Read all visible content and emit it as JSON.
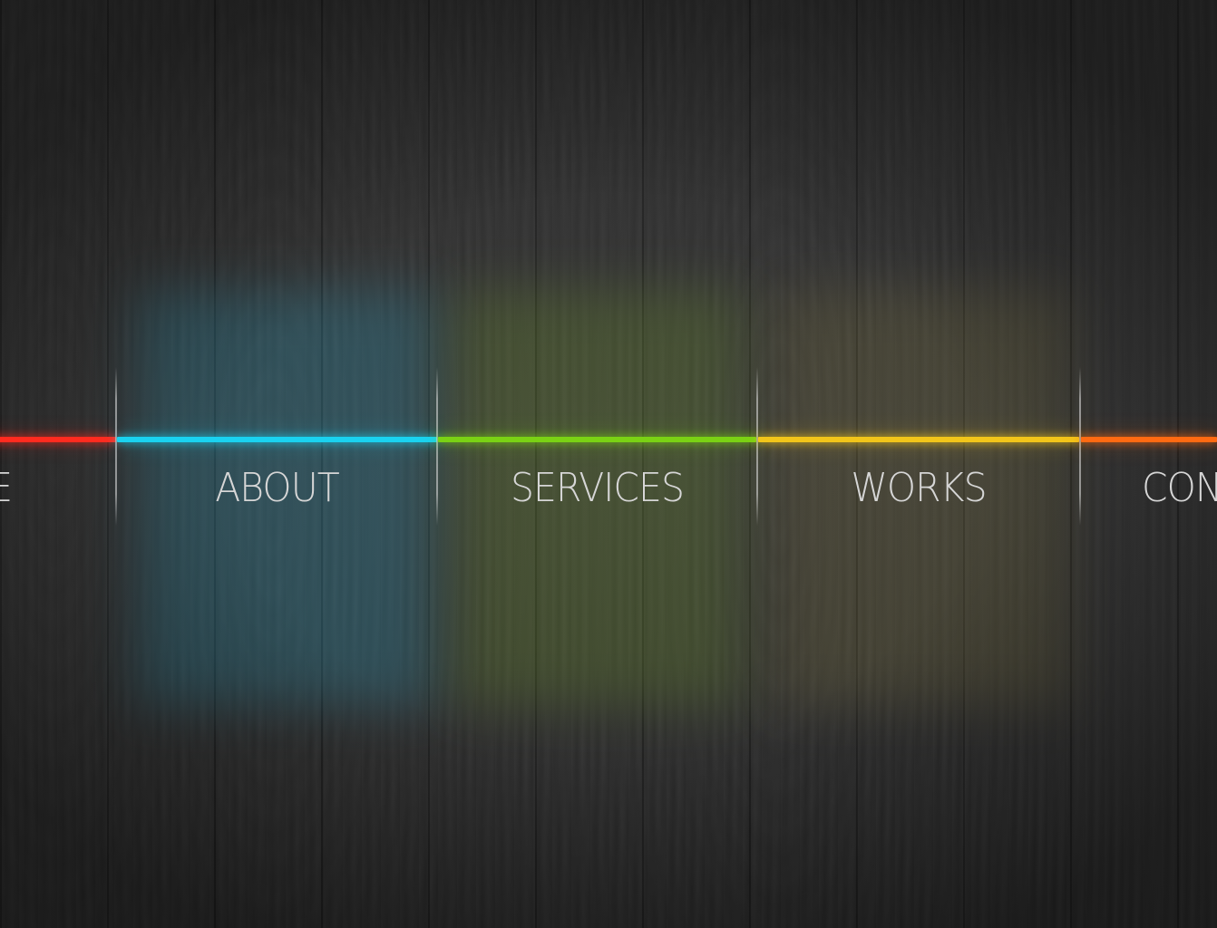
{
  "nav": {
    "items": [
      {
        "key": "home",
        "label": "E",
        "color": "#ff2b1f"
      },
      {
        "key": "about",
        "label": "ABOUT",
        "color": "#1ad2f0"
      },
      {
        "key": "services",
        "label": "SERVICES",
        "color": "#7ad214"
      },
      {
        "key": "works",
        "label": "WORKS",
        "color": "#f2c51a"
      },
      {
        "key": "contact",
        "label": "CON",
        "color": "#ff6a12"
      }
    ]
  }
}
